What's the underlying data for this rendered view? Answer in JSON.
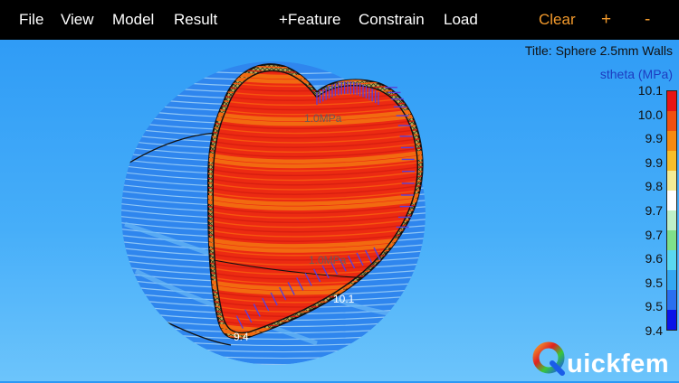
{
  "menu": {
    "file": "File",
    "view": "View",
    "model": "Model",
    "result": "Result",
    "feature": "+Feature",
    "constrain": "Constrain",
    "load": "Load",
    "clear": "Clear",
    "zoom_in": "+",
    "zoom_out": "-"
  },
  "title": "Title: Sphere 2.5mm Walls",
  "legend": {
    "title": "stheta (MPa)",
    "ticks": [
      "10.1",
      "10.0",
      "9.9",
      "9.9",
      "9.8",
      "9.7",
      "9.7",
      "9.6",
      "9.5",
      "9.5",
      "9.4"
    ],
    "colors": [
      "#e81414",
      "#f05010",
      "#f58a10",
      "#f7be2a",
      "#f3ec96",
      "#ffffff",
      "#bff0c8",
      "#7fe08a",
      "#5ad8f0",
      "#34a8f2",
      "#2a6ff0",
      "#0a14e8"
    ]
  },
  "annotations": {
    "pressure_top": "1.0MPa",
    "pressure_mid": "1.0MPa",
    "value_right": "10.1",
    "value_min": "9.4"
  },
  "logo": {
    "text": "uickfem",
    "colors": {
      "orange": "#f39a2c",
      "red": "#e02020",
      "green": "#38c838",
      "blue": "#1a5de8"
    }
  }
}
